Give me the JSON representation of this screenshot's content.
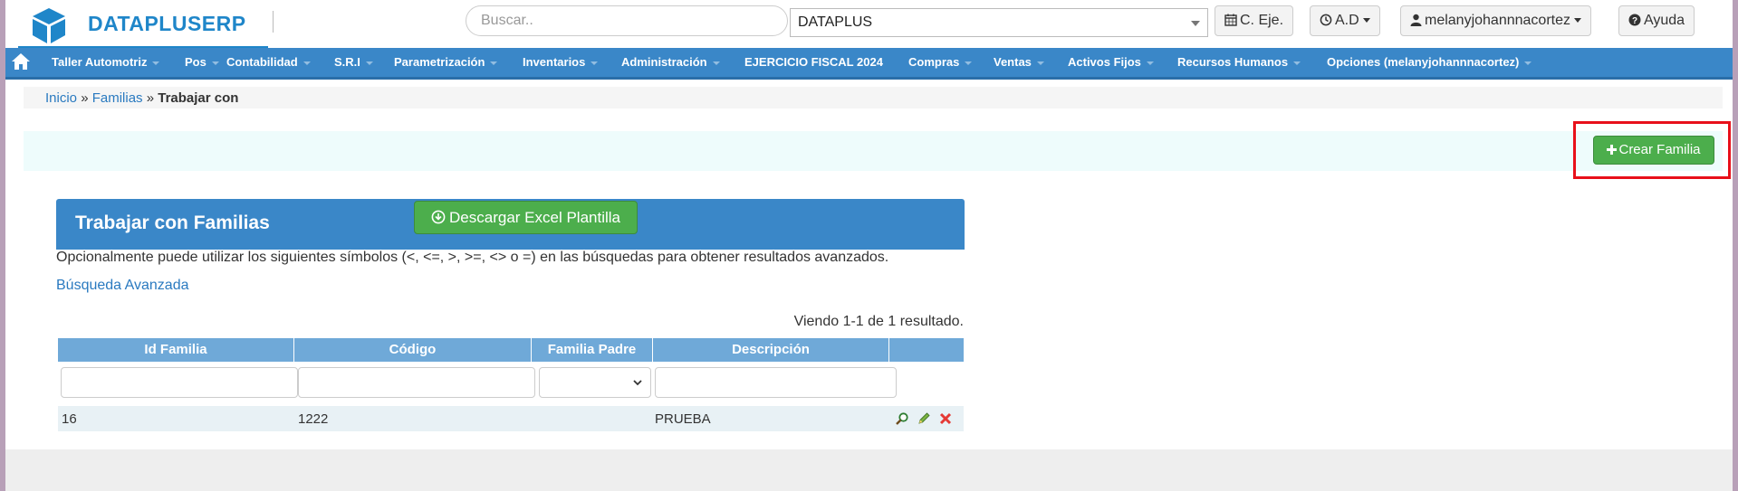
{
  "header": {
    "brand": "DATAPLUSERP",
    "search_placeholder": "Buscar..",
    "company": "DATAPLUS",
    "btn_ejercicio": "C. Eje.",
    "btn_ad": "A.D",
    "btn_user": "melanyjohannnacortez",
    "btn_help": "Ayuda"
  },
  "nav": {
    "items": [
      "Taller Automotriz",
      "Pos",
      "Contabilidad",
      "S.R.I",
      "Parametrización",
      "Inventarios",
      "Administración",
      "EJERCICIO FISCAL 2024",
      "Compras",
      "Ventas",
      "Activos Fijos",
      "Recursos Humanos",
      "Opciones (melanyjohannnacortez)"
    ]
  },
  "breadcrumb": {
    "home": "Inicio",
    "section": "Familias",
    "sep": "»",
    "current": "Trabajar con"
  },
  "actions": {
    "create": "Crear Familia",
    "download": "Descargar Excel Plantilla"
  },
  "panel": {
    "title": "Trabajar con Familias",
    "hint": "Opcionalmente puede utilizar los siguientes símbolos (<, <=, >, >=, <> o =) en las búsquedas para obtener resultados avanzados.",
    "advanced": "Búsqueda Avanzada",
    "summary": "Viendo 1-1 de 1 resultado."
  },
  "grid": {
    "columns": [
      "Id Familia",
      "Código",
      "Familia Padre",
      "Descripción",
      ""
    ],
    "rows": [
      {
        "id": "16",
        "codigo": "1222",
        "padre": "",
        "descripcion": "PRUEBA"
      }
    ]
  },
  "colors": {
    "brand_blue": "#1f86c9",
    "nav_blue": "#3a87c8",
    "success_green": "#4cae4c",
    "highlight_red": "#e8101a"
  }
}
